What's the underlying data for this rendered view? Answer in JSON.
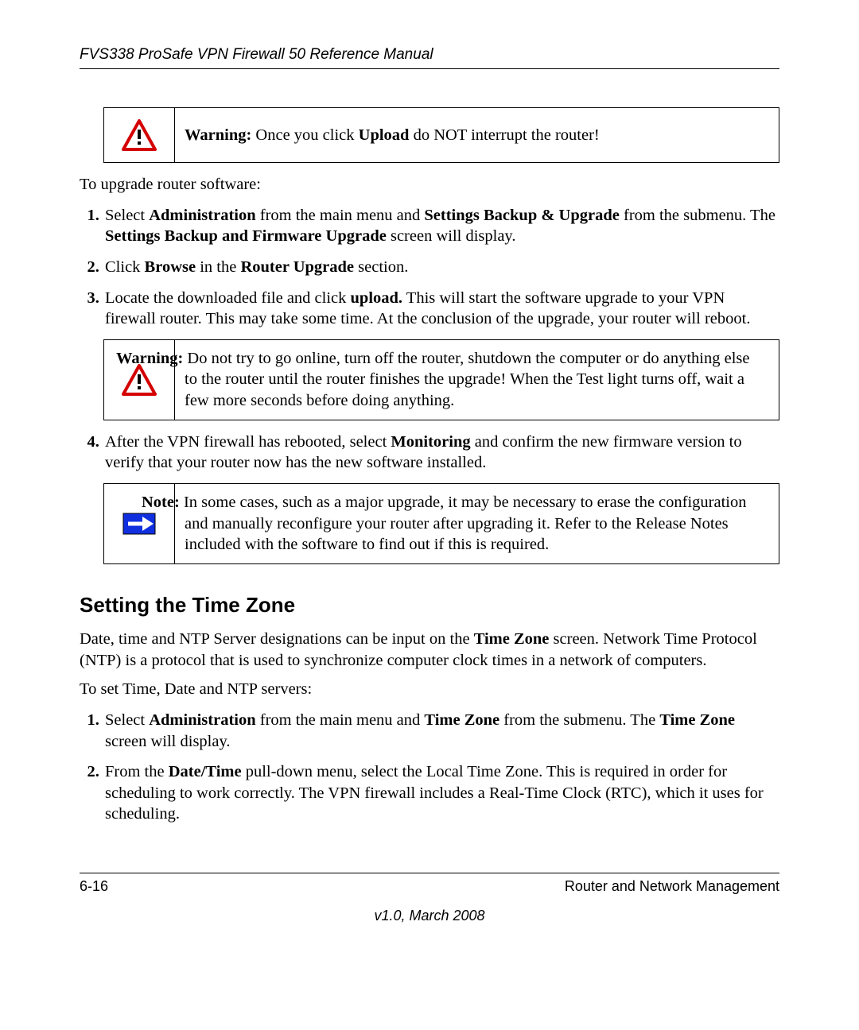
{
  "doc_title": "FVS338 ProSafe VPN Firewall 50 Reference Manual",
  "warning1": {
    "label": "Warning:",
    "t1": " Once you click ",
    "b1": "Upload",
    "t2": " do NOT interrupt the router!"
  },
  "intro_upgrade": "To upgrade router software:",
  "s1": {
    "t1": "Select ",
    "b1": "Administration",
    "t2": " from the main menu and ",
    "b2": "Settings Backup & Upgrade",
    "t3": " from the submenu. The ",
    "b3": "Settings Backup and Firmware Upgrade",
    "t4": " screen will display."
  },
  "s2": {
    "t1": "Click ",
    "b1": "Browse",
    "t2": " in the ",
    "b2": "Router Upgrade",
    "t3": " section."
  },
  "s3": {
    "t1": "Locate the downloaded file and click ",
    "b1": "upload.",
    "t2": " This will start the software upgrade to your VPN firewall router. This may take some time. At the conclusion of the upgrade, your router will reboot."
  },
  "warning2": {
    "label": "Warning:",
    "text": " Do not try to go online, turn off the router, shutdown the computer or do anything else to the router until the router finishes the upgrade! When the Test light turns off, wait a few more seconds before doing anything."
  },
  "s4": {
    "t1": "After the VPN firewall has rebooted, select ",
    "b1": "Monitoring",
    "t2": " and confirm the new firmware version to verify that your router now has the new software installed."
  },
  "note1": {
    "label": "Note:",
    "text": " In some cases, such as a major upgrade, it may be necessary to erase the configuration and manually reconfigure your router after upgrading it. Refer to the Release Notes included with the software to find out if this is required."
  },
  "heading_tz": "Setting the Time Zone",
  "tz_para": {
    "t1": "Date, time and NTP Server designations can be input on the ",
    "b1": "Time Zone",
    "t2": " screen. Network Time Protocol (NTP) is a protocol that is used to synchronize computer clock times in a network of computers."
  },
  "tz_intro": "To set Time, Date and NTP servers:",
  "tz1": {
    "t1": "Select ",
    "b1": "Administration",
    "t2": " from the main menu and ",
    "b2": "Time Zone",
    "t3": " from the submenu. The ",
    "b3": "Time Zone",
    "t4": " screen will display."
  },
  "tz2": {
    "t1": "From the ",
    "b1": "Date/Time",
    "t2": " pull-down menu, select the Local Time Zone. This is required in order for scheduling to work correctly. The VPN firewall includes a Real-Time Clock (RTC), which it uses for scheduling."
  },
  "footer": {
    "page": "6-16",
    "section": "Router and Network Management",
    "version": "v1.0, March 2008"
  }
}
